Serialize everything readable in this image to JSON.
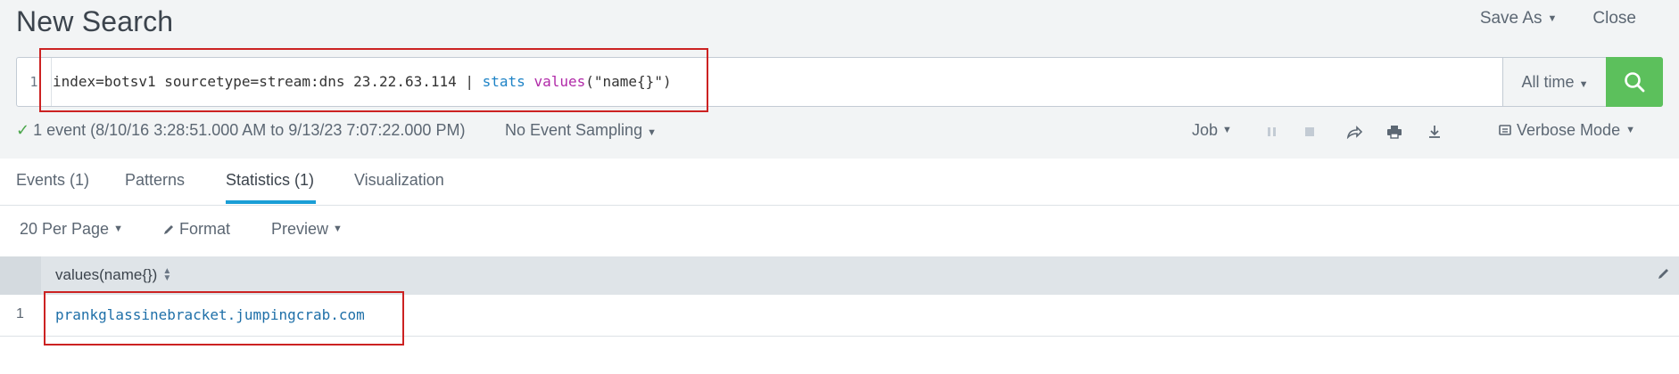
{
  "header": {
    "title": "New Search",
    "save_as": "Save As",
    "close": "Close"
  },
  "search": {
    "line_number": "1",
    "query_plain": "index=botsv1 sourcetype=stream:dns 23.22.63.114 | ",
    "query_cmd": "stats",
    "query_fn": "values",
    "query_args": "(\"name{}\")",
    "time_range": "All time"
  },
  "status": {
    "events_summary": "1 event (8/10/16 3:28:51.000 AM to 9/13/23 7:07:22.000 PM)",
    "sampling": "No Event Sampling",
    "job": "Job",
    "mode": "Verbose Mode"
  },
  "tabs": [
    {
      "label": "Events (1)",
      "active": false
    },
    {
      "label": "Patterns",
      "active": false
    },
    {
      "label": "Statistics (1)",
      "active": true
    },
    {
      "label": "Visualization",
      "active": false
    }
  ],
  "table_tools": {
    "per_page": "20 Per Page",
    "format": "Format",
    "preview": "Preview"
  },
  "table": {
    "column_header": "values(name{})",
    "rows": [
      {
        "num": "1",
        "value": "prankglassinebracket.jumpingcrab.com"
      }
    ]
  },
  "colors": {
    "accent_blue": "#1a9ed6",
    "search_green": "#5cc05c",
    "annotation_red": "#cc2222"
  },
  "icons": [
    "chevron-down-icon",
    "search-icon",
    "check-icon",
    "pause-icon",
    "stop-icon",
    "share-icon",
    "print-icon",
    "download-icon",
    "mode-icon",
    "pencil-icon",
    "sort-icon",
    "edit-column-icon"
  ]
}
